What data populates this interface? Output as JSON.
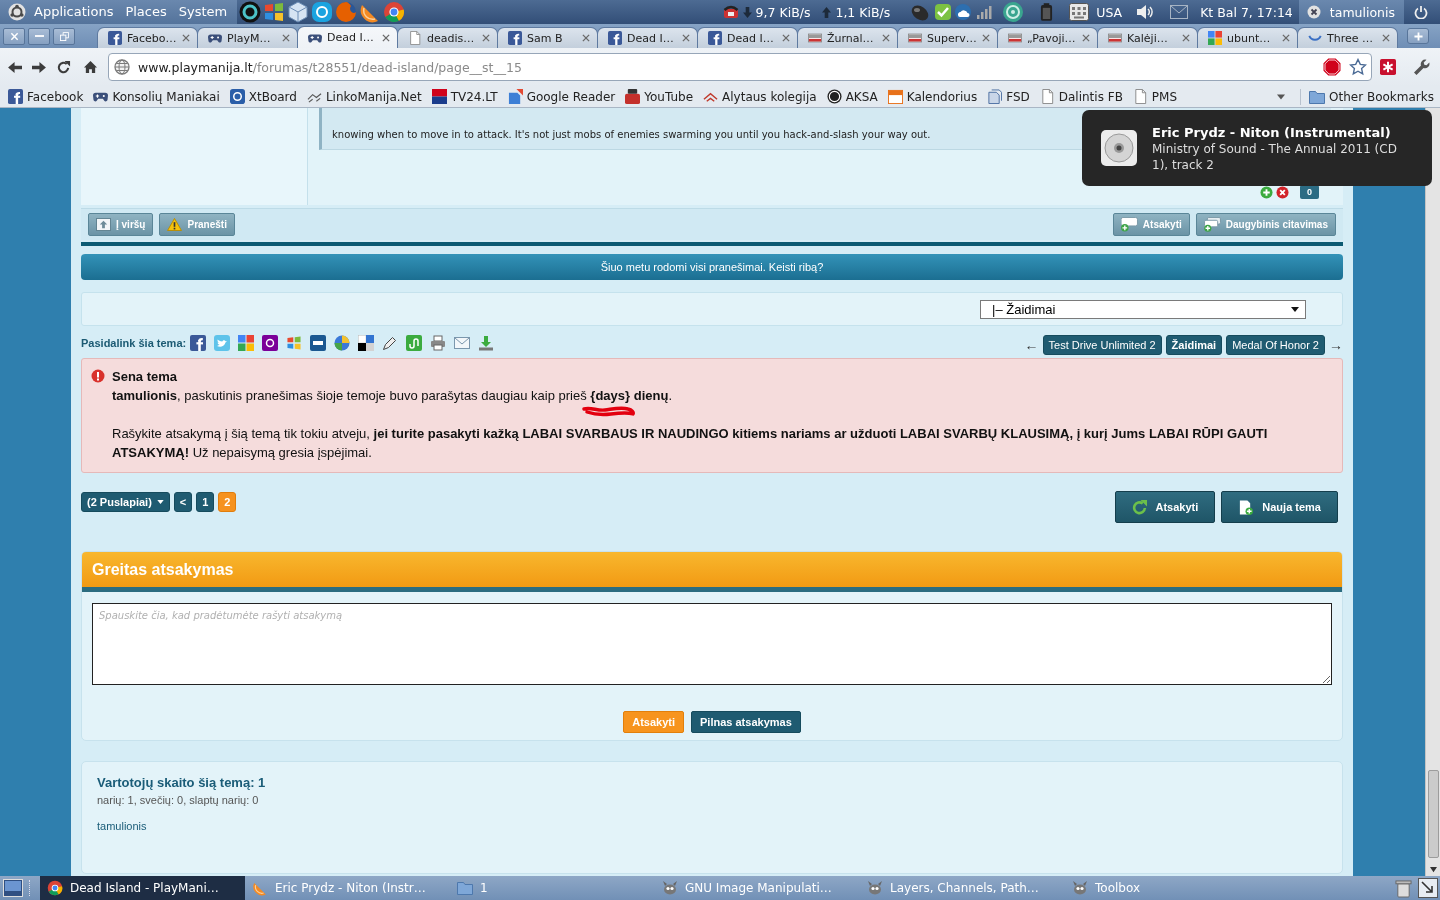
{
  "top_panel": {
    "menus": [
      "Applications",
      "Places",
      "System"
    ],
    "net_down": "9,7 KiB/s",
    "net_up": "1,1 KiB/s",
    "keyboard_layout": "USA",
    "clock": "Kt Bal 7, 17:14",
    "user": "tamulionis"
  },
  "browser": {
    "tabs": [
      {
        "label": "Facebo…",
        "kind": "facebook",
        "selected": false
      },
      {
        "label": "PlayM…",
        "kind": "gamepad",
        "selected": false
      },
      {
        "label": "Dead I…",
        "kind": "gamepad",
        "selected": true
      },
      {
        "label": "deadis…",
        "kind": "page",
        "selected": false
      },
      {
        "label": "Sam B",
        "kind": "facebook",
        "selected": false
      },
      {
        "label": "Dead I…",
        "kind": "facebook",
        "selected": false
      },
      {
        "label": "Dead I…",
        "kind": "facebook",
        "selected": false
      },
      {
        "label": "Žurnal…",
        "kind": "news",
        "selected": false
      },
      {
        "label": "Superv…",
        "kind": "news",
        "selected": false
      },
      {
        "label": "„Pavoji…",
        "kind": "news",
        "selected": false
      },
      {
        "label": "Kalėji…",
        "kind": "news",
        "selected": false
      },
      {
        "label": "ubunt…",
        "kind": "google",
        "selected": false
      },
      {
        "label": "Three …",
        "kind": "loading",
        "selected": false
      }
    ],
    "address": {
      "host": "www.playmanija.lt",
      "path": "/forumas/t28551/dead-island/page__st__15"
    },
    "bookmarks": [
      {
        "label": "Facebook",
        "kind": "facebook"
      },
      {
        "label": "Konsolių Maniakai",
        "kind": "gamepad"
      },
      {
        "label": "XtBoard",
        "kind": "xt"
      },
      {
        "label": "LinkoManija.Net",
        "kind": "link"
      },
      {
        "label": "TV24.LT",
        "kind": "tv"
      },
      {
        "label": "Google Reader",
        "kind": "reader"
      },
      {
        "label": "YouTube",
        "kind": "video"
      },
      {
        "label": "Alytaus kolegija",
        "kind": "roof"
      },
      {
        "label": "AKSA",
        "kind": "wordpress"
      },
      {
        "label": "Kalendorius",
        "kind": "calendar"
      },
      {
        "label": "FSD",
        "kind": "docs"
      },
      {
        "label": "Dalintis FB",
        "kind": "page"
      },
      {
        "label": "PMS",
        "kind": "page"
      }
    ],
    "other_bookmarks": "Other Bookmarks"
  },
  "post": {
    "quote": "knowing when to move in to attack. It's not just mobs of enemies swarming you until you hack-and-slash your way out.",
    "rating": "0",
    "left_buttons": [
      {
        "label": "Į viršų",
        "kind": "top"
      },
      {
        "label": "Pranešti",
        "kind": "report"
      }
    ],
    "right_buttons": [
      {
        "label": "Atsakyti",
        "kind": "reply"
      },
      {
        "label": "Daugybinis citavimas",
        "kind": "multiquote"
      }
    ]
  },
  "filter_notice": "Šiuo metu rodomi visi pranešimai. Keisti ribą?",
  "forum_jump": {
    "value": "|– Žaidimai"
  },
  "share": {
    "label": "Pasidalink šia tema:"
  },
  "topic_nav": {
    "prev": "←",
    "items": [
      {
        "label": "Test Drive Unlimited 2",
        "kind": "topic"
      },
      {
        "label": "Žaidimai",
        "kind": "forum"
      },
      {
        "label": "Medal Of Honor 2",
        "kind": "topic"
      }
    ],
    "next": "→"
  },
  "notice": {
    "title": "Sena tema",
    "message": "**tamulionis**, paskutinis pranešimas šioje temoje buvo parašytas daugiau kaip prieš **{days} dienų**.",
    "warning": "Rašykite atsakymą į šią temą tik tokiu atveju, **jei turite pasakyti kažką LABAI SVARBAUS IR NAUDINGO kitiems nariams ar užduoti LABAI SVARBŲ KLAUSIMĄ, į kurį Jums LABAI RŪPI GAUTI ATSAKYMĄ!** Už nepaisymą gresia įspėjimai."
  },
  "pagination": {
    "pages_label": "(2 Puslapiai)",
    "prev": "<",
    "pages": [
      {
        "label": "1",
        "selected": false
      },
      {
        "label": "2",
        "selected": true
      }
    ]
  },
  "actions": [
    {
      "label": "Atsakyti",
      "kind": "reply"
    },
    {
      "label": "Nauja tema",
      "kind": "new"
    }
  ],
  "quick_reply": {
    "title": "Greitas atsakymas",
    "placeholder": "Spauskite čia, kad pradėtumėte rašyti atsakymą",
    "buttons": [
      {
        "label": "Atsakyti",
        "kind": "primary"
      },
      {
        "label": "Pilnas atsakymas",
        "kind": "secondary"
      }
    ]
  },
  "viewers": {
    "title": "Vartotojų skaito šią temą: 1",
    "counts": "narių: 1, svečių: 0, slaptų narių: 0",
    "users": [
      "tamulionis"
    ]
  },
  "notification": {
    "title": "Eric Prydz - Niton (Instrumental)",
    "body": "Ministry of Sound - The Annual 2011 (CD 1), track 2"
  },
  "taskbar": {
    "tasks": [
      {
        "label": "Dead Island - PlayMani…",
        "kind": "browser",
        "selected": true
      },
      {
        "label": "Eric Prydz - Niton (Instr…",
        "kind": "player",
        "selected": false
      },
      {
        "label": "1",
        "kind": "folder",
        "selected": false
      },
      {
        "label": "GNU Image Manipulati…",
        "kind": "gimp",
        "selected": false
      },
      {
        "label": "Layers, Channels, Path…",
        "kind": "gimp",
        "selected": false
      },
      {
        "label": "Toolbox",
        "kind": "gimp",
        "selected": false
      }
    ]
  }
}
